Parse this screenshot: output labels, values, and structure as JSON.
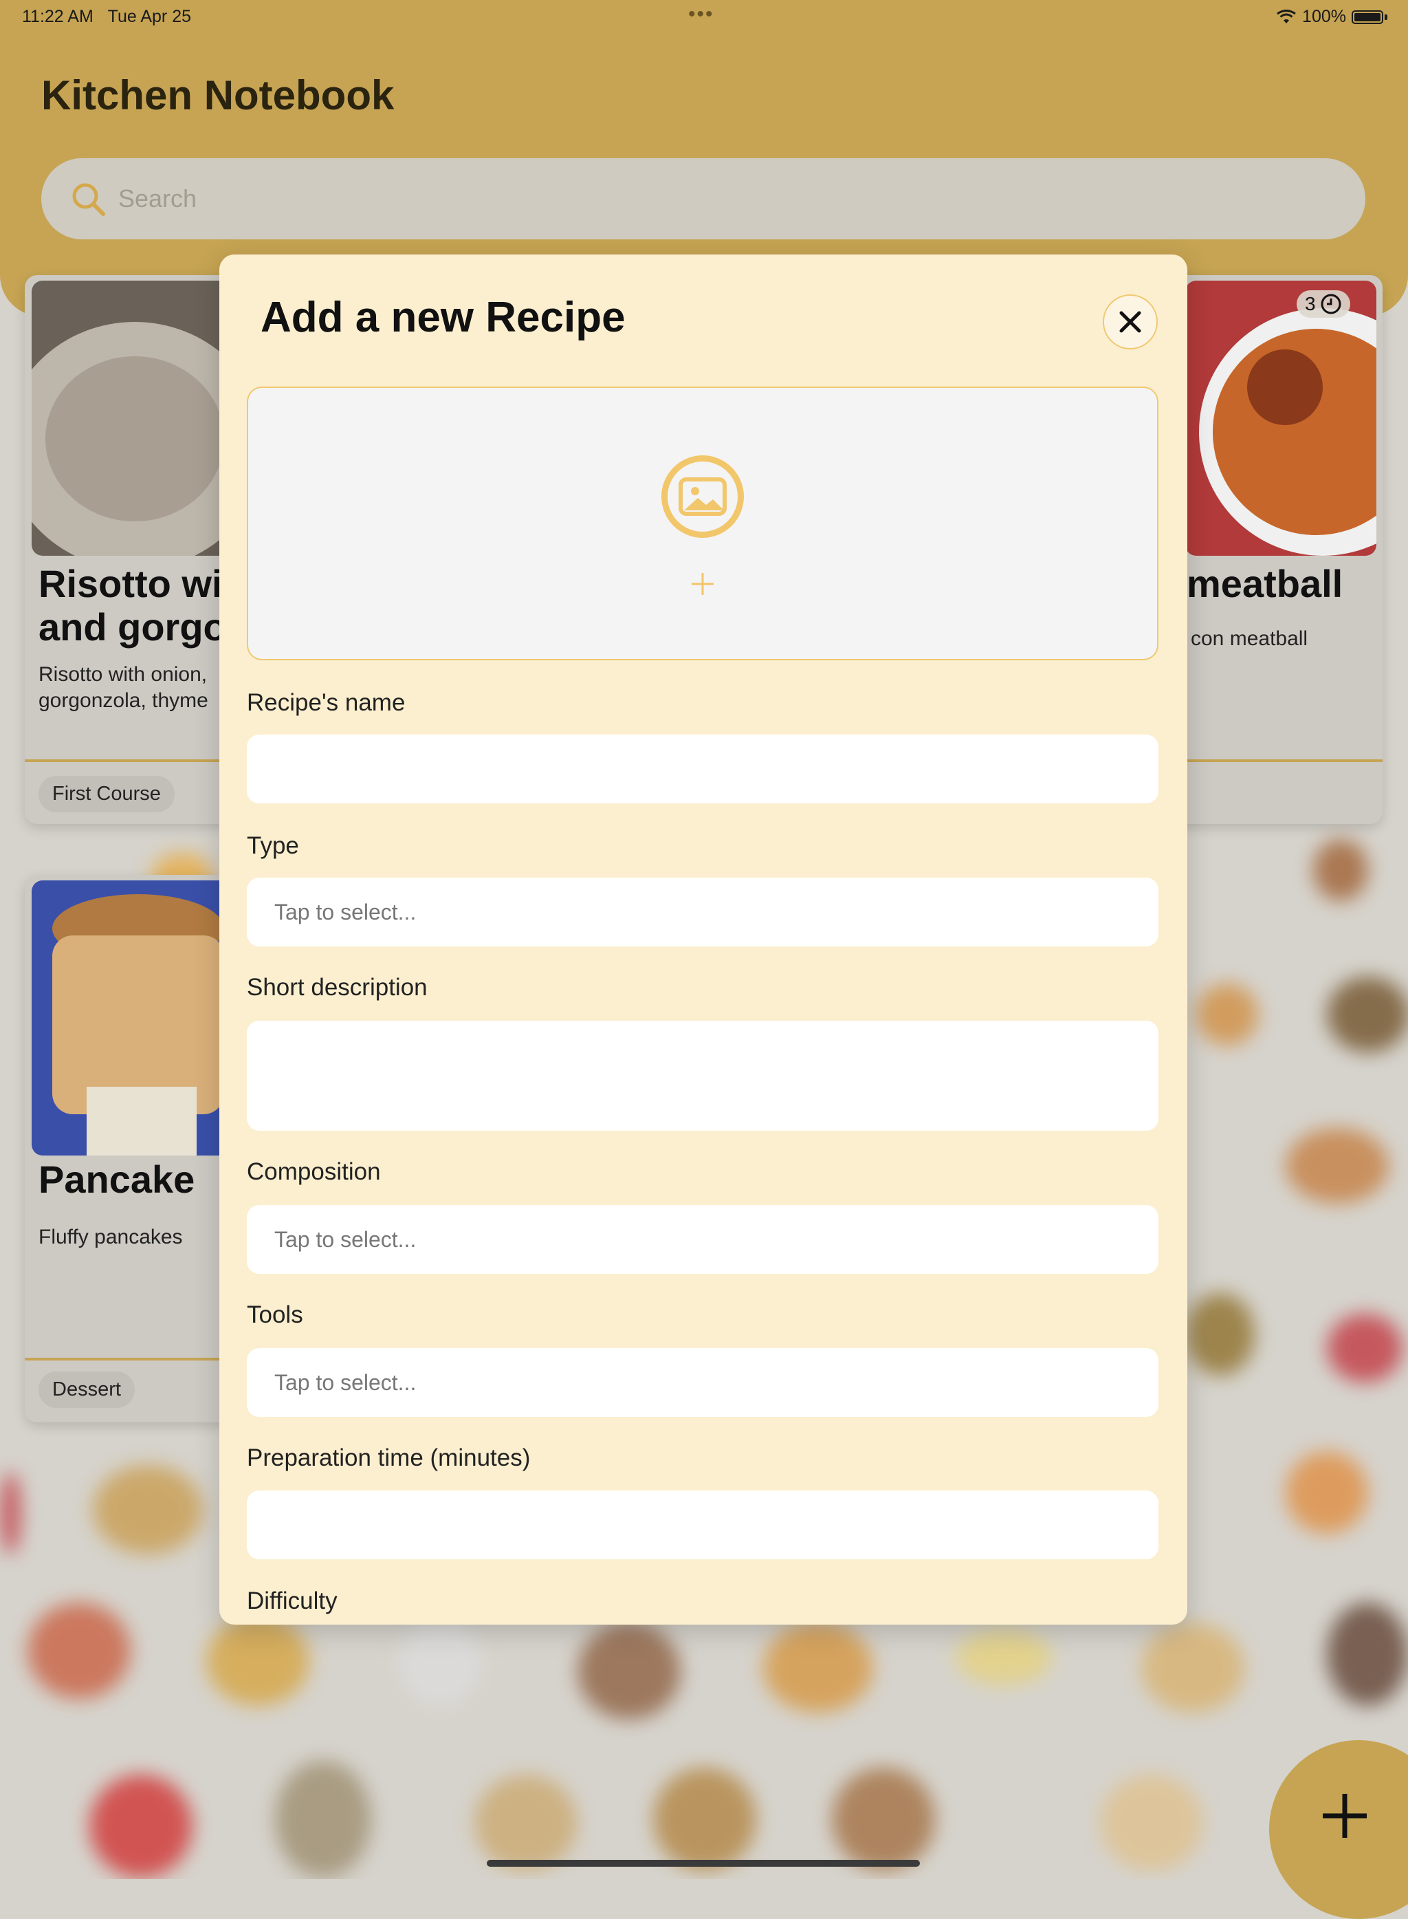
{
  "status_bar": {
    "time": "11:22 AM",
    "date": "Tue Apr 25",
    "battery": "100%"
  },
  "app": {
    "title": "Kitchen Notebook"
  },
  "search": {
    "placeholder": "Search"
  },
  "cards": [
    {
      "title": "Risotto wit\nand gorgo",
      "description": "Risotto with onion,\ngorgonzola, thyme",
      "tag": "First Course"
    },
    {
      "title": "meatball",
      "description": "con meatball",
      "badge": "3"
    },
    {
      "title": "Pancake",
      "description": "Fluffy pancakes",
      "tag": "Dessert"
    }
  ],
  "modal": {
    "title": "Add a new Recipe",
    "labels": {
      "name": "Recipe's name",
      "type": "Type",
      "description": "Short description",
      "composition": "Composition",
      "tools": "Tools",
      "prep_time": "Preparation time (minutes)",
      "difficulty": "Difficulty"
    },
    "placeholders": {
      "type": "Tap to select...",
      "composition": "Tap to select...",
      "tools": "Tap to select..."
    }
  },
  "colors": {
    "accent": "#c6a453",
    "modal_bg": "#fbefcf",
    "icon_yellow": "#f2c66a"
  },
  "icons": [
    "search-icon",
    "close-icon",
    "image-icon",
    "plus-icon",
    "clock-icon",
    "wifi-icon",
    "battery-icon"
  ]
}
